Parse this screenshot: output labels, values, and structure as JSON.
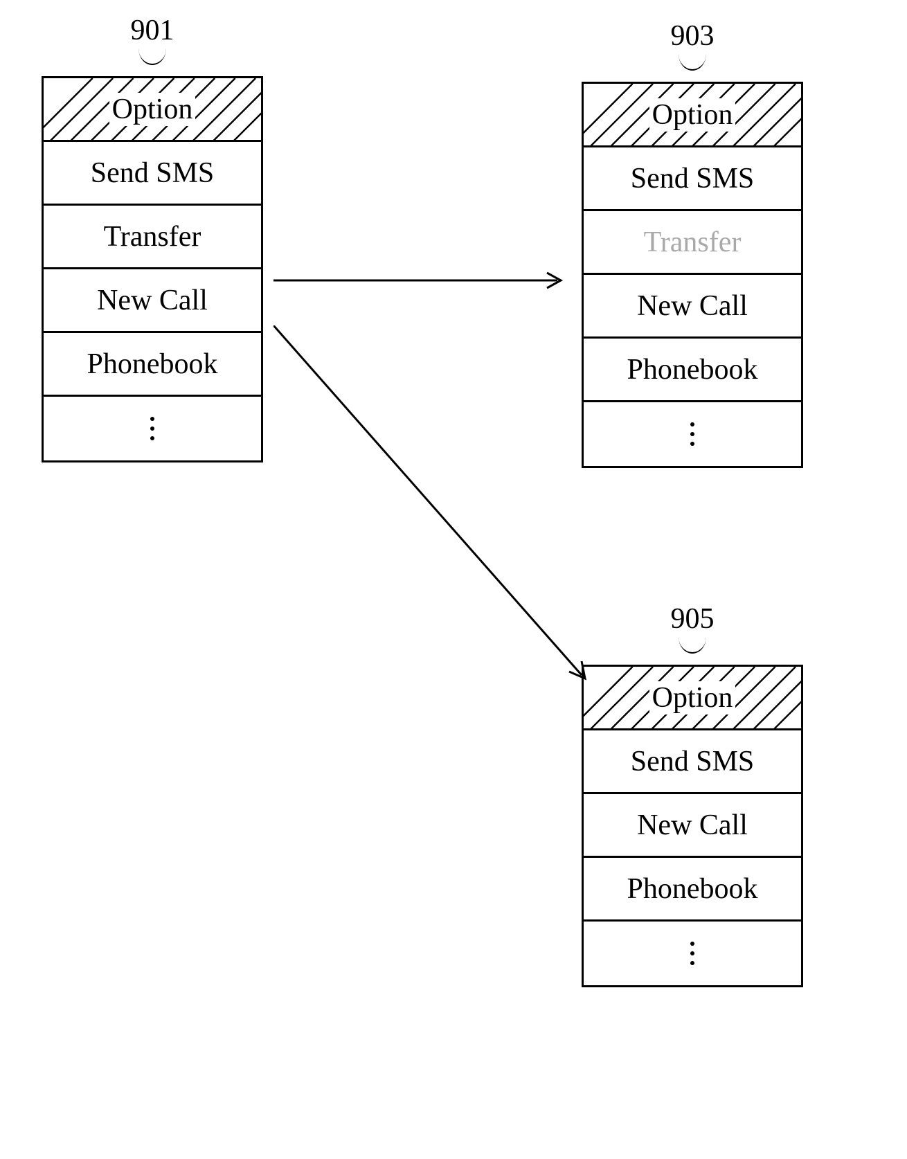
{
  "labels": {
    "ref901": "901",
    "ref903": "903",
    "ref905": "905"
  },
  "menus": {
    "m901": {
      "header": "Option",
      "items": [
        "Send SMS",
        "Transfer",
        "New Call",
        "Phonebook"
      ]
    },
    "m903": {
      "header": "Option",
      "items": [
        "Send SMS",
        "Transfer",
        "New Call",
        "Phonebook"
      ],
      "disabled_item": "Transfer"
    },
    "m905": {
      "header": "Option",
      "items": [
        "Send SMS",
        "New Call",
        "Phonebook"
      ]
    }
  }
}
